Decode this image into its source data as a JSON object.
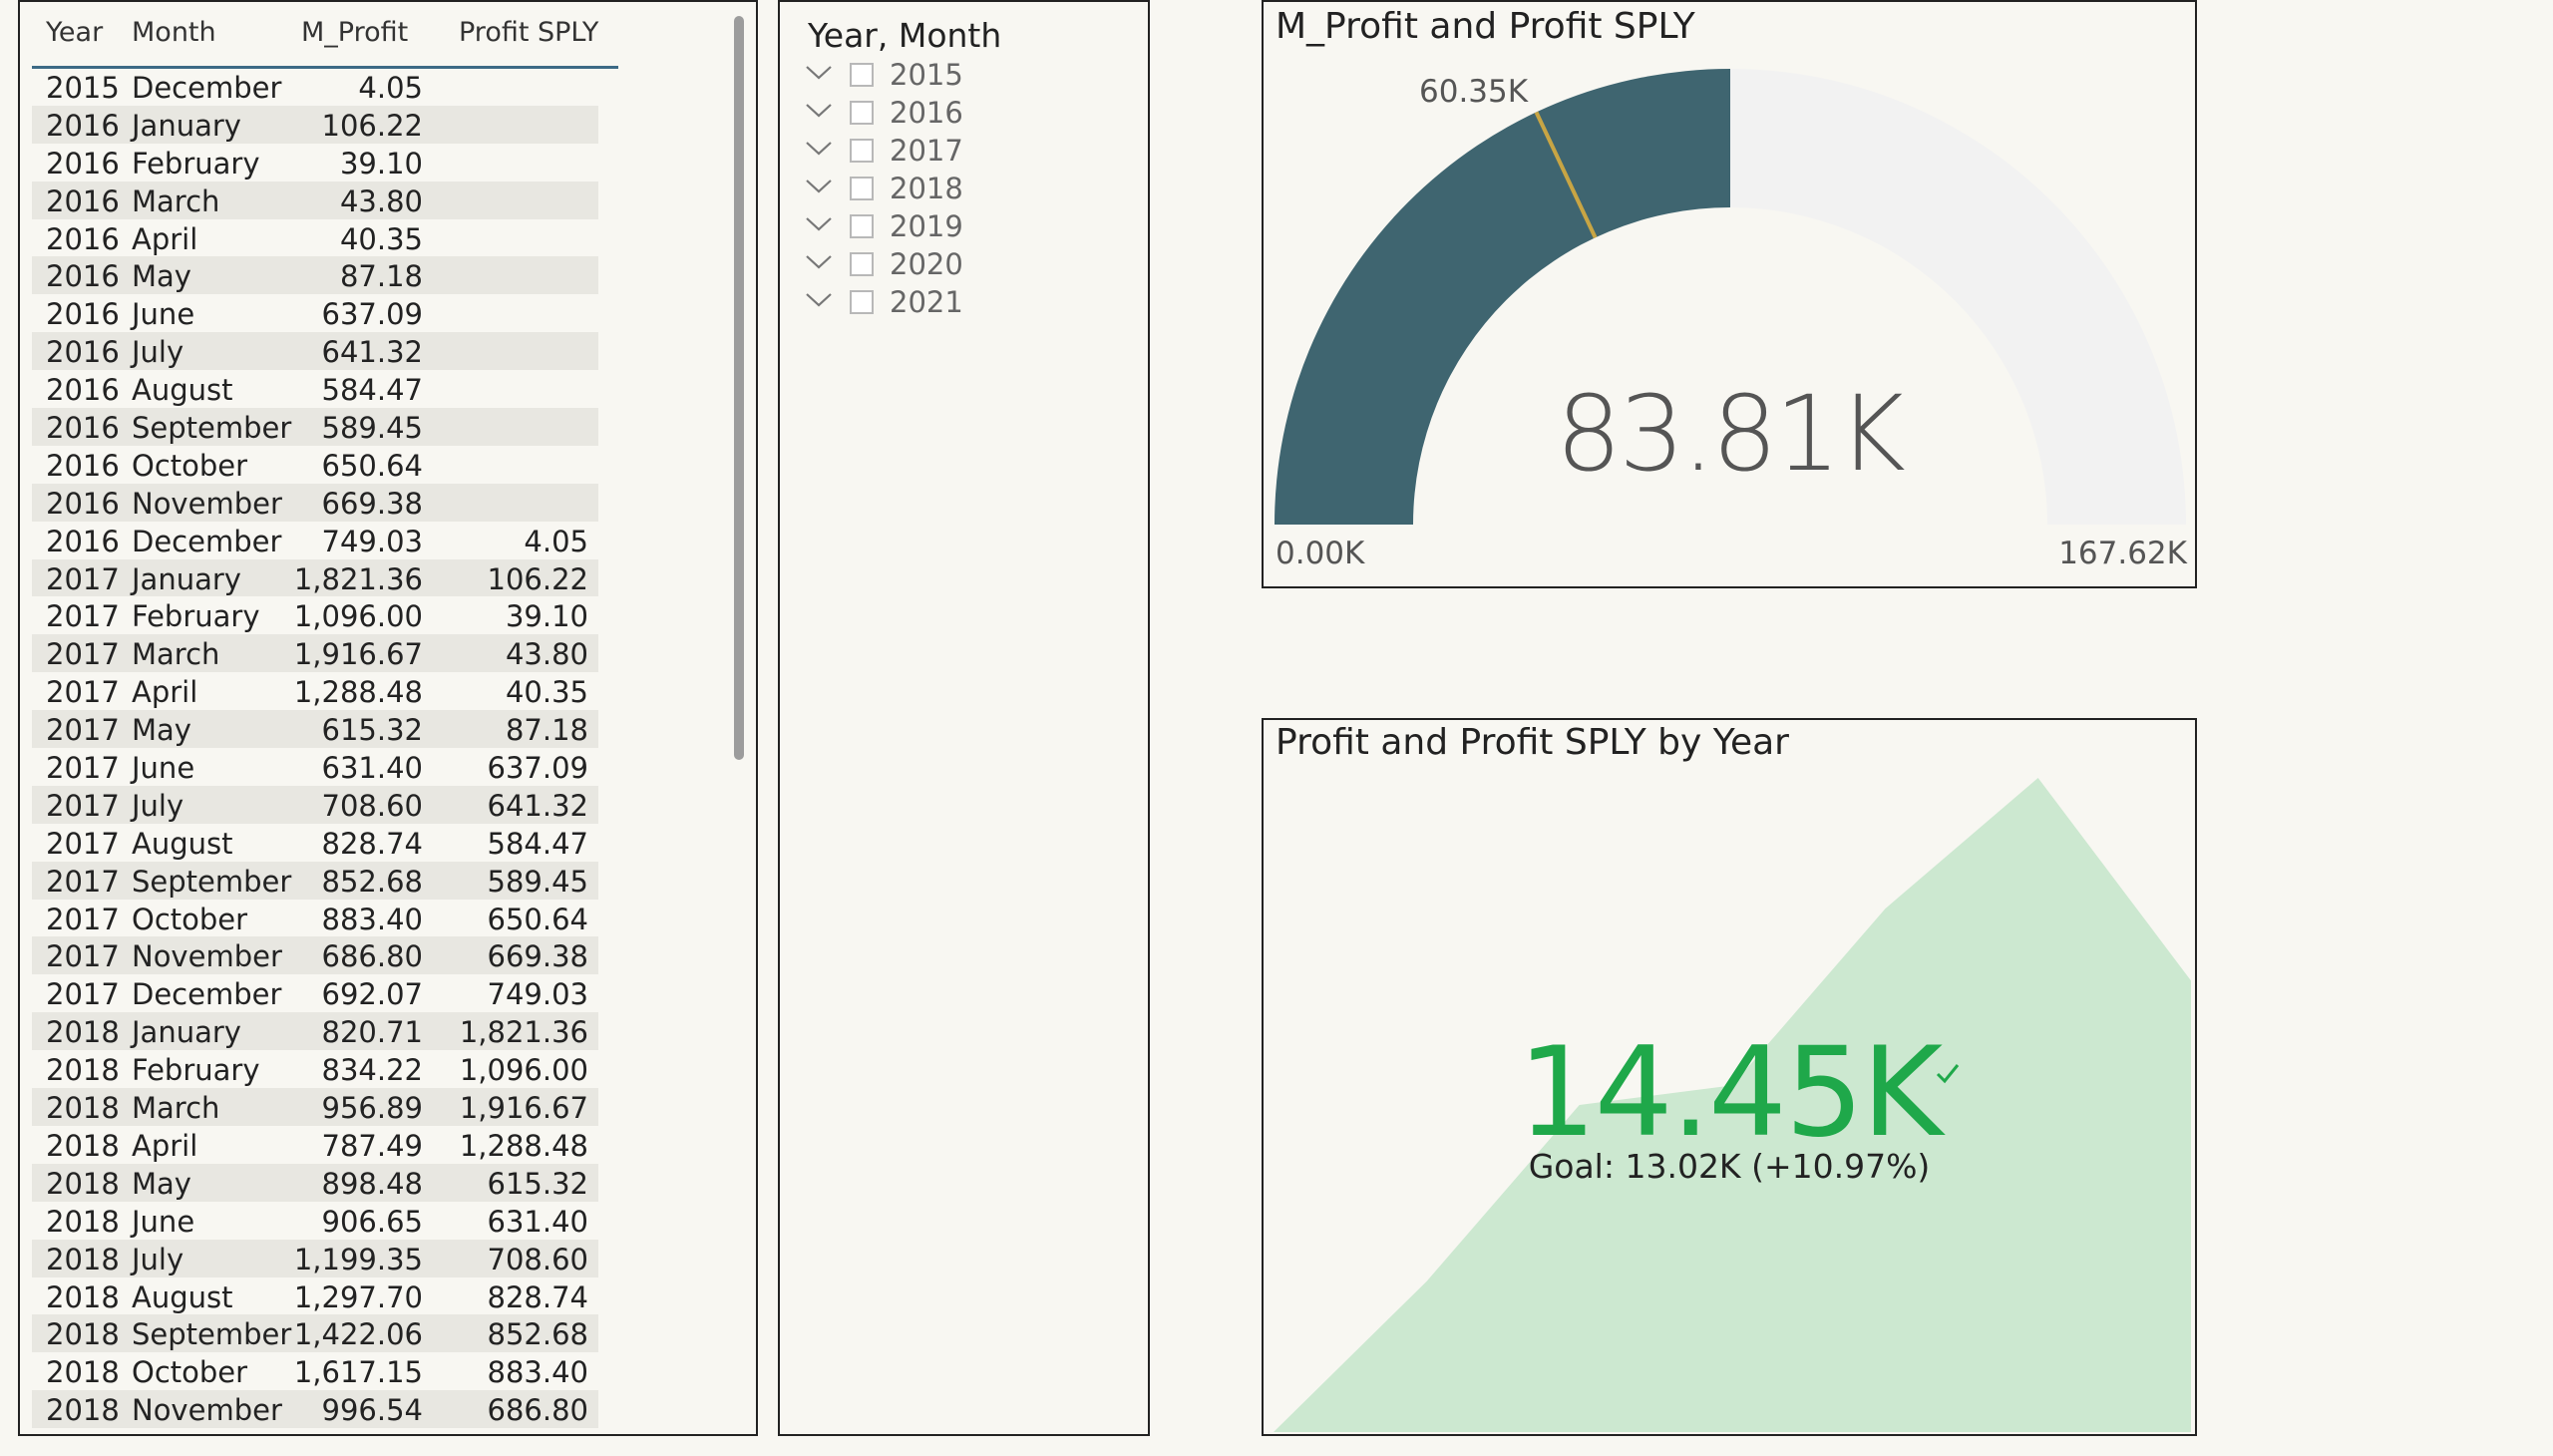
{
  "table": {
    "headers": [
      "Year",
      "Month",
      "M_Profit",
      "Profit SPLY"
    ],
    "rows": [
      [
        "2015",
        "December",
        "4.05",
        ""
      ],
      [
        "2016",
        "January",
        "106.22",
        ""
      ],
      [
        "2016",
        "February",
        "39.10",
        ""
      ],
      [
        "2016",
        "March",
        "43.80",
        ""
      ],
      [
        "2016",
        "April",
        "40.35",
        ""
      ],
      [
        "2016",
        "May",
        "87.18",
        ""
      ],
      [
        "2016",
        "June",
        "637.09",
        ""
      ],
      [
        "2016",
        "July",
        "641.32",
        ""
      ],
      [
        "2016",
        "August",
        "584.47",
        ""
      ],
      [
        "2016",
        "September",
        "589.45",
        ""
      ],
      [
        "2016",
        "October",
        "650.64",
        ""
      ],
      [
        "2016",
        "November",
        "669.38",
        ""
      ],
      [
        "2016",
        "December",
        "749.03",
        "4.05"
      ],
      [
        "2017",
        "January",
        "1,821.36",
        "106.22"
      ],
      [
        "2017",
        "February",
        "1,096.00",
        "39.10"
      ],
      [
        "2017",
        "March",
        "1,916.67",
        "43.80"
      ],
      [
        "2017",
        "April",
        "1,288.48",
        "40.35"
      ],
      [
        "2017",
        "May",
        "615.32",
        "87.18"
      ],
      [
        "2017",
        "June",
        "631.40",
        "637.09"
      ],
      [
        "2017",
        "July",
        "708.60",
        "641.32"
      ],
      [
        "2017",
        "August",
        "828.74",
        "584.47"
      ],
      [
        "2017",
        "September",
        "852.68",
        "589.45"
      ],
      [
        "2017",
        "October",
        "883.40",
        "650.64"
      ],
      [
        "2017",
        "November",
        "686.80",
        "669.38"
      ],
      [
        "2017",
        "December",
        "692.07",
        "749.03"
      ],
      [
        "2018",
        "January",
        "820.71",
        "1,821.36"
      ],
      [
        "2018",
        "February",
        "834.22",
        "1,096.00"
      ],
      [
        "2018",
        "March",
        "956.89",
        "1,916.67"
      ],
      [
        "2018",
        "April",
        "787.49",
        "1,288.48"
      ],
      [
        "2018",
        "May",
        "898.48",
        "615.32"
      ],
      [
        "2018",
        "June",
        "906.65",
        "631.40"
      ],
      [
        "2018",
        "July",
        "1,199.35",
        "708.60"
      ],
      [
        "2018",
        "August",
        "1,297.70",
        "828.74"
      ],
      [
        "2018",
        "September",
        "1,422.06",
        "852.68"
      ],
      [
        "2018",
        "October",
        "1,617.15",
        "883.40"
      ],
      [
        "2018",
        "November",
        "996.54",
        "686.80"
      ]
    ]
  },
  "slicer": {
    "title": "Year, Month",
    "items": [
      "2015",
      "2016",
      "2017",
      "2018",
      "2019",
      "2020",
      "2021"
    ],
    "checkbox_states": [
      false,
      false,
      false,
      false,
      false,
      false,
      false
    ],
    "icons": {
      "expand": "chevron-down-icon"
    }
  },
  "gauge": {
    "title": "M_Profit and Profit SPLY",
    "value_label": "83.81K",
    "min_label": "0.00K",
    "max_label": "167.62K",
    "target_label": "60.35K",
    "value": 83.81,
    "min": 0,
    "max": 167.62,
    "target": 60.35,
    "colors": {
      "fill": "#3f6570",
      "track": "#f2f2f2",
      "target": "#c8a544"
    }
  },
  "kpi": {
    "title": "Profit and Profit SPLY by Year",
    "value_label": "14.45K",
    "goal_label": "Goal: 13.02K (+10.97%)",
    "trend": [
      0,
      0.23,
      0.5,
      0.53,
      0.8,
      1.0,
      0.69
    ],
    "colors": {
      "value": "#1fa84a",
      "area": "#cce8d0"
    },
    "icons": {
      "status": "check-icon"
    }
  }
}
